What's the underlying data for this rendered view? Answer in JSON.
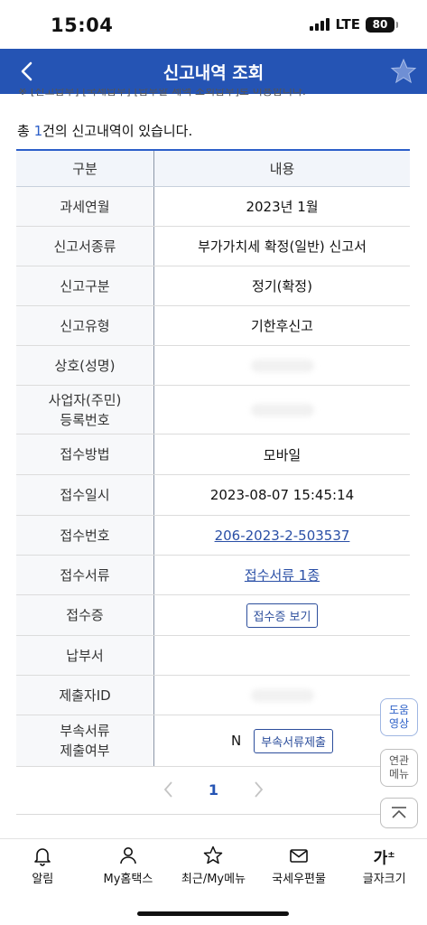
{
  "status_bar": {
    "time": "15:04",
    "network": "LTE",
    "battery": "80"
  },
  "header": {
    "title": "신고내역 조회"
  },
  "notice": {
    "text": "※ [신고납부] [국세납부] [납부할 세액 조회납부]로 이용합니다."
  },
  "summary": {
    "prefix": "총 ",
    "count": "1",
    "suffix": "건의 신고내역이 있습니다."
  },
  "table": {
    "headers": {
      "category": "구분",
      "content": "내용"
    },
    "rows": {
      "tax_period": {
        "label": "과세연월",
        "value": "2023년 1월"
      },
      "report_type": {
        "label": "신고서종류",
        "value": "부가가치세 확정(일반) 신고서"
      },
      "report_class": {
        "label": "신고구분",
        "value": "정기(확정)"
      },
      "report_kind": {
        "label": "신고유형",
        "value": "기한후신고"
      },
      "trade_name": {
        "label": "상호(성명)"
      },
      "business_no": {
        "label_line1": "사업자(주민)",
        "label_line2": "등록번호"
      },
      "receipt_method": {
        "label": "접수방법",
        "value": "모바일"
      },
      "receipt_datetime": {
        "label": "접수일시",
        "value": "2023-08-07 15:45:14"
      },
      "receipt_no": {
        "label": "접수번호",
        "value": "206-2023-2-503537"
      },
      "receipt_docs": {
        "label": "접수서류",
        "value": "접수서류 1종"
      },
      "receipt_cert": {
        "label": "접수증",
        "button": "접수증 보기"
      },
      "payment_slip": {
        "label": "납부서"
      },
      "submitter_id": {
        "label": "제출자ID"
      },
      "attached_docs": {
        "label_line1": "부속서류",
        "label_line2": "제출여부",
        "value": "N",
        "button": "부속서류제출"
      }
    }
  },
  "pagination": {
    "current": "1"
  },
  "side_buttons": {
    "help": {
      "line1": "도움",
      "line2": "영상"
    },
    "related": {
      "line1": "연관",
      "line2": "메뉴"
    }
  },
  "bottom_nav": {
    "alerts": "알림",
    "my_hometax": "My홈택스",
    "recent": "최근/My메뉴",
    "mailbox": "국세우편물",
    "font_size": "글자크기",
    "font_icon": "가"
  },
  "colors": {
    "primary": "#2554b4",
    "link": "#2a4fa6",
    "accent_number": "#2c5fc9"
  }
}
